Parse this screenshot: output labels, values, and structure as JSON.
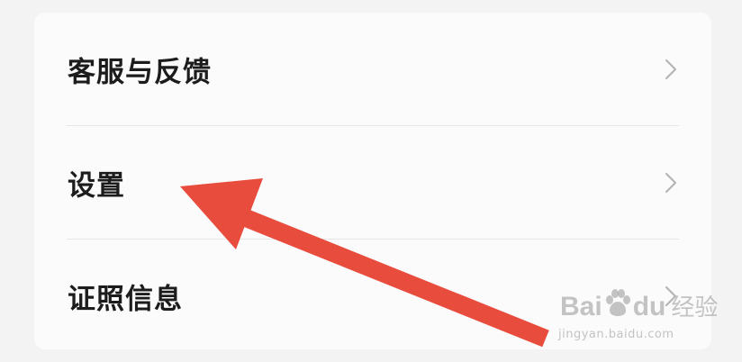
{
  "menu": {
    "items": [
      {
        "label": "客服与反馈",
        "icon": "chevron-right-icon"
      },
      {
        "label": "设置",
        "icon": "chevron-right-icon"
      },
      {
        "label": "证照信息",
        "icon": "chevron-right-icon"
      }
    ]
  },
  "annotation": {
    "type": "arrow",
    "color": "#e84c3d",
    "points_to": "设置"
  },
  "watermark": {
    "brand_left": "Bai",
    "brand_right": "du",
    "brand_cn": "经验",
    "url": "jingyan.baidu.com"
  },
  "colors": {
    "background": "#f3f3f3",
    "card": "#fbfbfb",
    "text": "#1c1c1c",
    "chevron": "#b5b5b5",
    "divider": "#e6e6e6"
  }
}
